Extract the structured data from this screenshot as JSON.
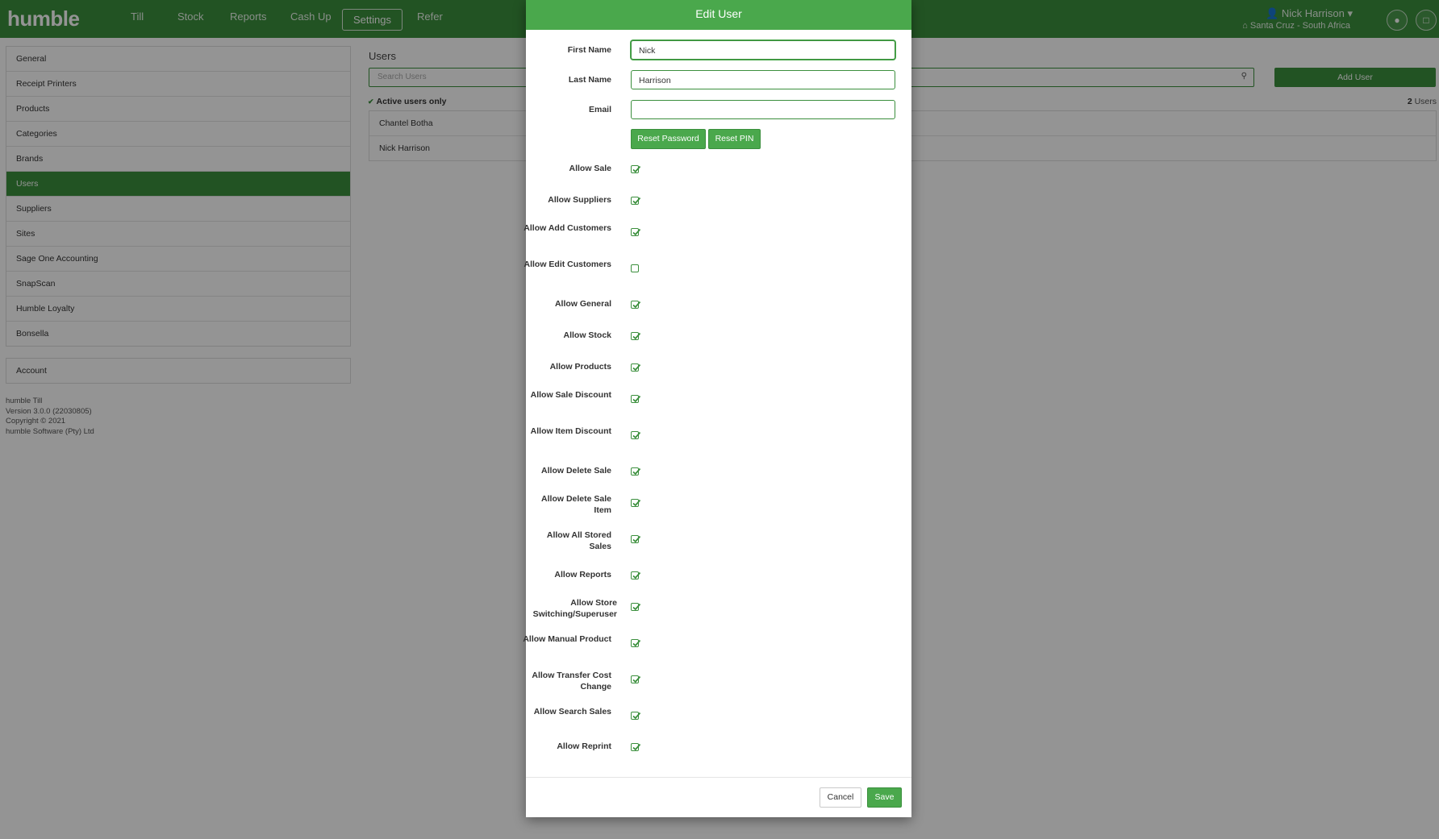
{
  "app": {
    "logo": "humble",
    "nav": [
      "Till",
      "Stock",
      "Reports",
      "Cash Up",
      "Settings",
      "Refer"
    ],
    "active_nav": "Settings",
    "user_name": "Nick Harrison",
    "site_name": "Santa Cruz - South Africa",
    "user_caret": "▾",
    "user_icon": "person-icon",
    "site_icon": "home-icon",
    "chat_icon": "chat-icon",
    "lock_icon": "lock-icon"
  },
  "sidebar": {
    "items": [
      "General",
      "Receipt Printers",
      "Products",
      "Categories",
      "Brands",
      "Users",
      "Suppliers",
      "Sites",
      "Sage One Accounting",
      "SnapScan",
      "Humble Loyalty",
      "Bonsella"
    ],
    "active": "Users",
    "account": "Account"
  },
  "footer": {
    "line1": "humble Till",
    "line2": "Version 3.0.0 (22030805)",
    "line3": "Copyright © 2021",
    "line4": "humble Software (Pty) Ltd"
  },
  "main": {
    "title": "Users",
    "search_placeholder": "Search Users",
    "add_user": "Add User",
    "active_only": "Active users only",
    "count": "2",
    "count_label": "Users",
    "users": [
      "Chantel Botha",
      "Nick Harrison"
    ]
  },
  "modal": {
    "title": "Edit User",
    "first_name_label": "First Name",
    "first_name": "Nick",
    "last_name_label": "Last Name",
    "last_name": "Harrison",
    "email_label": "Email",
    "email": "",
    "reset_password": "Reset Password",
    "reset_pin": "Reset PIN",
    "permissions": [
      {
        "label": "Allow Sale",
        "checked": true
      },
      {
        "label": "Allow Suppliers",
        "checked": true
      },
      {
        "label": "Allow Add Customers",
        "checked": true
      },
      {
        "label": "Allow Edit Customers",
        "checked": false
      },
      {
        "label": "Allow General",
        "checked": true
      },
      {
        "label": "Allow Stock",
        "checked": true
      },
      {
        "label": "Allow Products",
        "checked": true
      },
      {
        "label": "Allow Sale Discount",
        "checked": true
      },
      {
        "label": "Allow Item Discount",
        "checked": true
      },
      {
        "label": "Allow Delete Sale",
        "checked": true
      },
      {
        "label": "Allow Delete Sale Item",
        "checked": true
      },
      {
        "label": "Allow All Stored Sales",
        "checked": true
      },
      {
        "label": "Allow Reports",
        "checked": true
      },
      {
        "label": "Allow Store Switching/Superuser",
        "checked": true
      },
      {
        "label": "Allow Manual Product",
        "checked": true
      },
      {
        "label": "Allow Transfer Cost Change",
        "checked": true
      },
      {
        "label": "Allow Search Sales",
        "checked": true
      },
      {
        "label": "Allow Reprint",
        "checked": true
      }
    ],
    "cancel": "Cancel",
    "save": "Save"
  }
}
